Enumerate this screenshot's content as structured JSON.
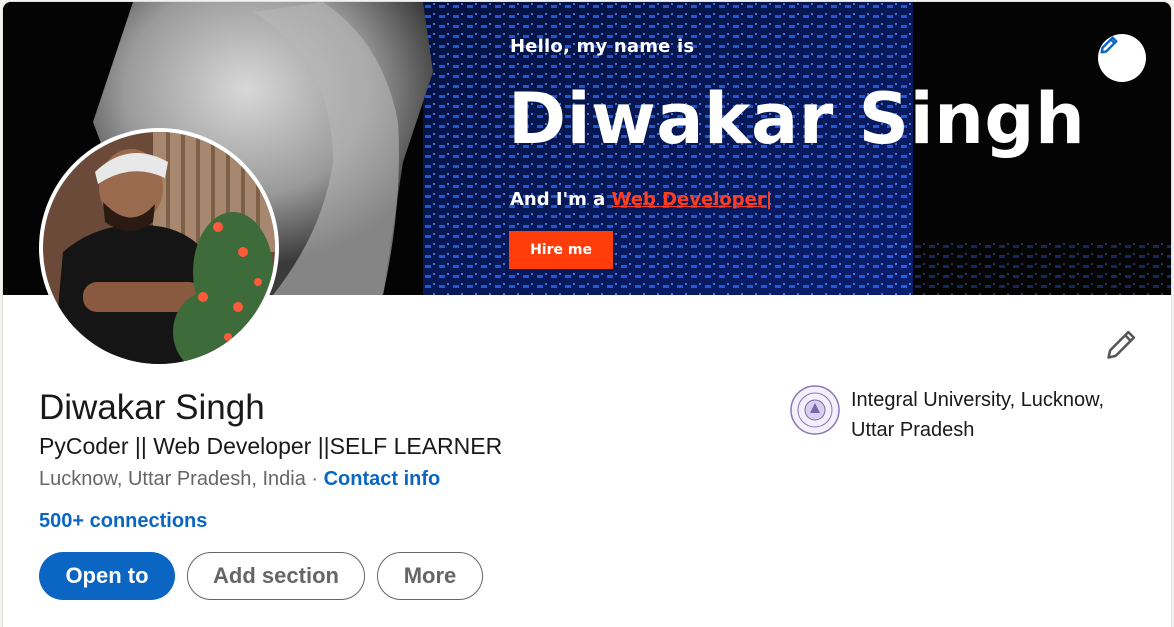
{
  "banner": {
    "hello": "Hello, my name is",
    "name": "Diwakar Singh",
    "role_prefix": "And I'm a ",
    "role_highlight": "Web Developer",
    "role_suffix": "|",
    "hire_button": "Hire me"
  },
  "profile": {
    "name": "Diwakar Singh",
    "headline": "PyCoder || Web Developer ||SELF LEARNER",
    "location": "Lucknow, Uttar Pradesh, India",
    "separator": " · ",
    "contact_info": "Contact info",
    "connections": "500+ connections"
  },
  "education": {
    "school": "Integral University, Lucknow, Uttar Pradesh"
  },
  "actions": {
    "open_to": "Open to",
    "add_section": "Add section",
    "more": "More"
  },
  "colors": {
    "brand_blue": "#0a66c2",
    "banner_accent": "#ff3d0a",
    "muted_text": "#666666"
  },
  "icons": {
    "edit_cover": "pencil-icon",
    "edit_intro": "pencil-outline-icon",
    "school_logo": "university-seal-icon"
  }
}
